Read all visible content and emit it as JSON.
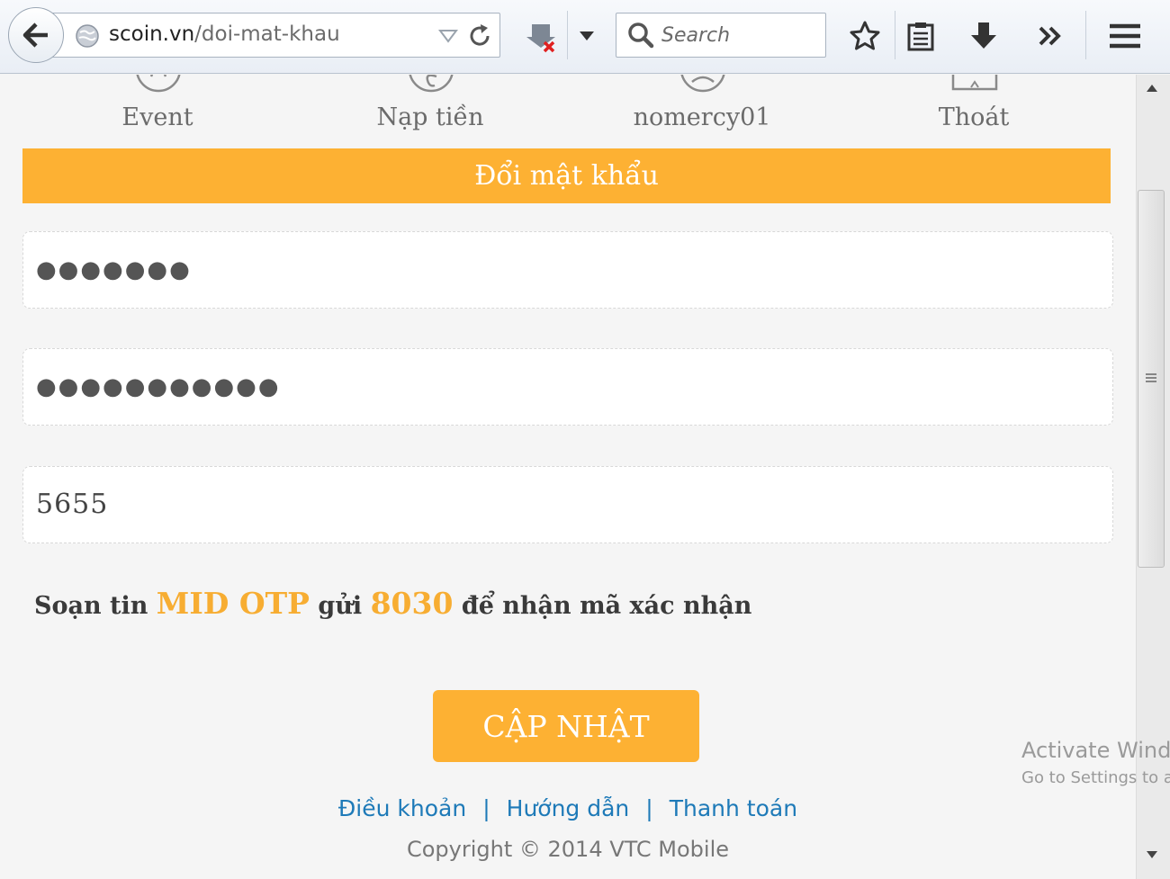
{
  "browser": {
    "url_host": "scoin.vn",
    "url_path": "/doi-mat-khau",
    "search_placeholder": "Search"
  },
  "nav": {
    "items": [
      {
        "label": "Event",
        "icon": "event-badge-icon"
      },
      {
        "label": "Nạp tiền",
        "icon": "dollar-coin-icon"
      },
      {
        "label": "nomercy01",
        "icon": "user-icon"
      },
      {
        "label": "Thoát",
        "icon": "logout-icon"
      }
    ]
  },
  "form": {
    "title": "Đổi mật khẩu",
    "old_password_mask": "●●●●●●●",
    "new_password_mask": "●●●●●●●●●●●",
    "otp_value": "5655",
    "hint": {
      "pre": "Soạn tin ",
      "code": "MID OTP",
      "mid": " gửi ",
      "number": "8030",
      "post": " để nhận mã xác nhận"
    },
    "submit_label": "CẬP NHẬT"
  },
  "footer": {
    "links": [
      "Điều khoản",
      "Hướng dẫn",
      "Thanh toán"
    ],
    "separator": "|",
    "copyright": "Copyright © 2014 VTC Mobile"
  },
  "watermark": {
    "line1": "Activate Wind",
    "line2": "Go to Settings to a"
  },
  "colors": {
    "accent": "#fdb133",
    "link": "#1e7ab8"
  }
}
